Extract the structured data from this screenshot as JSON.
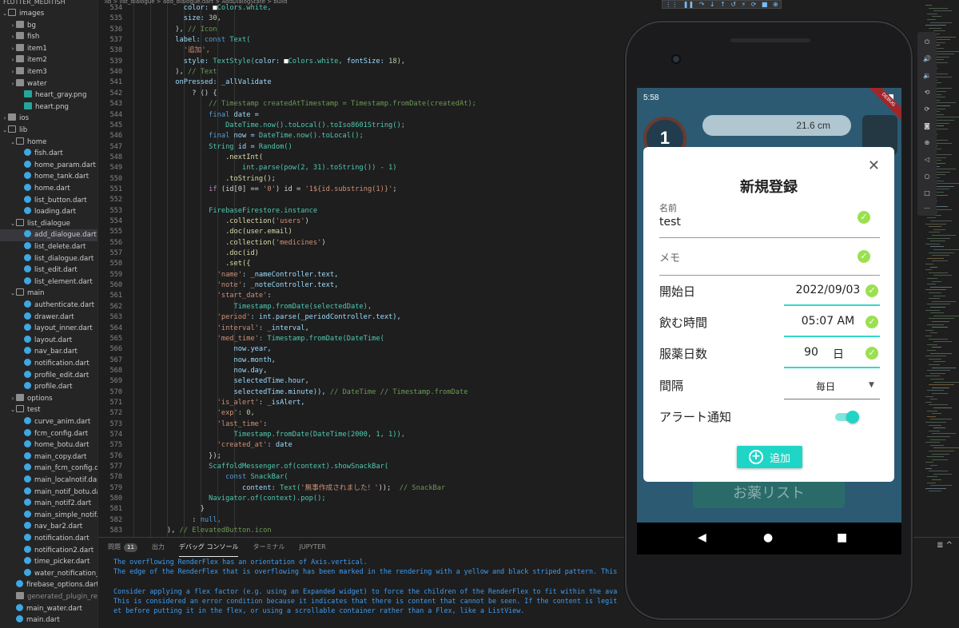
{
  "explorer": {
    "header": "FLUTTER_MEDITISH",
    "items": [
      {
        "label": "images",
        "kind": "folder-open",
        "indent": 0,
        "chev": "v"
      },
      {
        "label": "bg",
        "kind": "folder",
        "indent": 1,
        "chev": ">"
      },
      {
        "label": "fish",
        "kind": "folder",
        "indent": 1,
        "chev": ">"
      },
      {
        "label": "item1",
        "kind": "folder",
        "indent": 1,
        "chev": ">"
      },
      {
        "label": "item2",
        "kind": "folder",
        "indent": 1,
        "chev": ">"
      },
      {
        "label": "item3",
        "kind": "folder",
        "indent": 1,
        "chev": ">"
      },
      {
        "label": "water",
        "kind": "folder",
        "indent": 1,
        "chev": ">"
      },
      {
        "label": "heart_gray.png",
        "kind": "png",
        "indent": 2,
        "chev": ""
      },
      {
        "label": "heart.png",
        "kind": "png",
        "indent": 2,
        "chev": ""
      },
      {
        "label": "ios",
        "kind": "folder",
        "indent": 0,
        "chev": ">"
      },
      {
        "label": "lib",
        "kind": "folder-open",
        "indent": 0,
        "chev": "v"
      },
      {
        "label": "home",
        "kind": "folder-open",
        "indent": 1,
        "chev": "v"
      },
      {
        "label": "fish.dart",
        "kind": "dart",
        "indent": 2,
        "chev": ""
      },
      {
        "label": "home_param.dart",
        "kind": "dart",
        "indent": 2,
        "chev": ""
      },
      {
        "label": "home_tank.dart",
        "kind": "dart",
        "indent": 2,
        "chev": ""
      },
      {
        "label": "home.dart",
        "kind": "dart",
        "indent": 2,
        "chev": ""
      },
      {
        "label": "list_button.dart",
        "kind": "dart",
        "indent": 2,
        "chev": ""
      },
      {
        "label": "loading.dart",
        "kind": "dart",
        "indent": 2,
        "chev": ""
      },
      {
        "label": "list_dialogue",
        "kind": "folder-open",
        "indent": 1,
        "chev": "v"
      },
      {
        "label": "add_dialogue.dart",
        "kind": "dart",
        "indent": 2,
        "chev": "",
        "selected": true
      },
      {
        "label": "list_delete.dart",
        "kind": "dart",
        "indent": 2,
        "chev": ""
      },
      {
        "label": "list_dialogue.dart",
        "kind": "dart",
        "indent": 2,
        "chev": ""
      },
      {
        "label": "list_edit.dart",
        "kind": "dart",
        "indent": 2,
        "chev": ""
      },
      {
        "label": "list_element.dart",
        "kind": "dart",
        "indent": 2,
        "chev": ""
      },
      {
        "label": "main",
        "kind": "folder-open",
        "indent": 1,
        "chev": "v"
      },
      {
        "label": "authenticate.dart",
        "kind": "dart",
        "indent": 2,
        "chev": ""
      },
      {
        "label": "drawer.dart",
        "kind": "dart",
        "indent": 2,
        "chev": ""
      },
      {
        "label": "layout_inner.dart",
        "kind": "dart",
        "indent": 2,
        "chev": ""
      },
      {
        "label": "layout.dart",
        "kind": "dart",
        "indent": 2,
        "chev": ""
      },
      {
        "label": "nav_bar.dart",
        "kind": "dart",
        "indent": 2,
        "chev": ""
      },
      {
        "label": "notification.dart",
        "kind": "dart",
        "indent": 2,
        "chev": ""
      },
      {
        "label": "profile_edit.dart",
        "kind": "dart",
        "indent": 2,
        "chev": ""
      },
      {
        "label": "profile.dart",
        "kind": "dart",
        "indent": 2,
        "chev": ""
      },
      {
        "label": "options",
        "kind": "folder",
        "indent": 1,
        "chev": ">"
      },
      {
        "label": "test",
        "kind": "folder-open",
        "indent": 1,
        "chev": "v"
      },
      {
        "label": "curve_anim.dart",
        "kind": "dart",
        "indent": 2,
        "chev": ""
      },
      {
        "label": "fcm_config.dart",
        "kind": "dart",
        "indent": 2,
        "chev": ""
      },
      {
        "label": "home_botu.dart",
        "kind": "dart",
        "indent": 2,
        "chev": ""
      },
      {
        "label": "main_copy.dart",
        "kind": "dart",
        "indent": 2,
        "chev": ""
      },
      {
        "label": "main_fcm_config.d...",
        "kind": "dart",
        "indent": 2,
        "chev": ""
      },
      {
        "label": "main_localnotif.dart",
        "kind": "dart",
        "indent": 2,
        "chev": ""
      },
      {
        "label": "main_notif_botu.dart",
        "kind": "dart",
        "indent": 2,
        "chev": ""
      },
      {
        "label": "main_notif2.dart",
        "kind": "dart",
        "indent": 2,
        "chev": ""
      },
      {
        "label": "main_simple_notif...",
        "kind": "dart",
        "indent": 2,
        "chev": ""
      },
      {
        "label": "nav_bar2.dart",
        "kind": "dart",
        "indent": 2,
        "chev": ""
      },
      {
        "label": "notification.dart",
        "kind": "dart",
        "indent": 2,
        "chev": ""
      },
      {
        "label": "notification2.dart",
        "kind": "dart",
        "indent": 2,
        "chev": ""
      },
      {
        "label": "time_picker.dart",
        "kind": "dart",
        "indent": 2,
        "chev": ""
      },
      {
        "label": "water_notification_...",
        "kind": "dart",
        "indent": 2,
        "chev": ""
      },
      {
        "label": "firebase_options.dart",
        "kind": "dart",
        "indent": 1,
        "chev": ""
      },
      {
        "label": "generated_plugin_re...",
        "kind": "gen",
        "indent": 1,
        "chev": "",
        "dim": true
      },
      {
        "label": "main_water.dart",
        "kind": "dart",
        "indent": 1,
        "chev": ""
      },
      {
        "label": "main.dart",
        "kind": "dart",
        "indent": 1,
        "chev": ""
      }
    ]
  },
  "editor": {
    "breadcrumb": "lib > list_dialogue > add_dialogue.dart > AddDialogState > build",
    "first_line": 534,
    "lines": [
      [
        {
          "t": "            color: ",
          "c": "#9cdcfe"
        },
        {
          "t": "■",
          "c": "#ffffff"
        },
        {
          "t": "Colors.white,",
          "c": "#4ec9b0"
        }
      ],
      [
        {
          "t": "            size: ",
          "c": "#9cdcfe"
        },
        {
          "t": "30,",
          "c": "#b5cea8"
        }
      ],
      [
        {
          "t": "          ), ",
          "c": "#d4d4d4"
        },
        {
          "t": "// Icon",
          "c": "#6a9955"
        }
      ],
      [
        {
          "t": "          label: ",
          "c": "#9cdcfe"
        },
        {
          "t": "const ",
          "c": "#569cd6"
        },
        {
          "t": "Text(",
          "c": "#4ec9b0"
        }
      ],
      [
        {
          "t": "            '追加',",
          "c": "#ce9178"
        }
      ],
      [
        {
          "t": "            style: ",
          "c": "#9cdcfe"
        },
        {
          "t": "TextStyle(",
          "c": "#4ec9b0"
        },
        {
          "t": "color: ",
          "c": "#9cdcfe"
        },
        {
          "t": "■",
          "c": "#ffffff"
        },
        {
          "t": "Colors.white, ",
          "c": "#4ec9b0"
        },
        {
          "t": "fontSize: ",
          "c": "#9cdcfe"
        },
        {
          "t": "18),",
          "c": "#b5cea8"
        }
      ],
      [
        {
          "t": "          ), ",
          "c": "#d4d4d4"
        },
        {
          "t": "// Text",
          "c": "#6a9955"
        }
      ],
      [
        {
          "t": "          onPressed: ",
          "c": "#9cdcfe"
        },
        {
          "t": "_allValidate",
          "c": "#9cdcfe"
        }
      ],
      [
        {
          "t": "              ? () {",
          "c": "#d4d4d4"
        }
      ],
      [
        {
          "t": "                  // Timestamp createdAtTimestamp = Timestamp.fromDate(createdAt);",
          "c": "#6a9955"
        }
      ],
      [
        {
          "t": "                  final ",
          "c": "#569cd6"
        },
        {
          "t": "date =",
          "c": "#9cdcfe"
        }
      ],
      [
        {
          "t": "                      DateTime.now().toLocal().toIso8601String();",
          "c": "#4ec9b0"
        }
      ],
      [
        {
          "t": "                  final ",
          "c": "#569cd6"
        },
        {
          "t": "now = ",
          "c": "#9cdcfe"
        },
        {
          "t": "DateTime.now().toLocal();",
          "c": "#4ec9b0"
        }
      ],
      [
        {
          "t": "                  String ",
          "c": "#4ec9b0"
        },
        {
          "t": "id = ",
          "c": "#9cdcfe"
        },
        {
          "t": "Random()",
          "c": "#4ec9b0"
        }
      ],
      [
        {
          "t": "                      .nextInt(",
          "c": "#dcdcaa"
        }
      ],
      [
        {
          "t": "                          int.parse(pow(2, 31).toString()) - 1)",
          "c": "#4ec9b0"
        }
      ],
      [
        {
          "t": "                      .toString();",
          "c": "#dcdcaa"
        }
      ],
      [
        {
          "t": "                  if ",
          "c": "#c586c0"
        },
        {
          "t": "(id[0] == ",
          "c": "#d4d4d4"
        },
        {
          "t": "'0'",
          "c": "#ce9178"
        },
        {
          "t": ") id = ",
          "c": "#d4d4d4"
        },
        {
          "t": "'1${id.substring(1)}'",
          "c": "#ce9178"
        },
        {
          "t": ";",
          "c": "#d4d4d4"
        }
      ],
      [
        {
          "t": "",
          "c": "#d4d4d4"
        }
      ],
      [
        {
          "t": "                  FirebaseFirestore.instance",
          "c": "#4ec9b0"
        }
      ],
      [
        {
          "t": "                      .collection(",
          "c": "#dcdcaa"
        },
        {
          "t": "'users'",
          "c": "#ce9178"
        },
        {
          "t": ")",
          "c": "#d4d4d4"
        }
      ],
      [
        {
          "t": "                      .doc(user.email)",
          "c": "#dcdcaa"
        }
      ],
      [
        {
          "t": "                      .collection(",
          "c": "#dcdcaa"
        },
        {
          "t": "'medicines'",
          "c": "#ce9178"
        },
        {
          "t": ")",
          "c": "#d4d4d4"
        }
      ],
      [
        {
          "t": "                      .doc(id)",
          "c": "#dcdcaa"
        }
      ],
      [
        {
          "t": "                      .set({",
          "c": "#dcdcaa"
        }
      ],
      [
        {
          "t": "                    'name'",
          "c": "#ce9178"
        },
        {
          "t": ": _nameController.text,",
          "c": "#9cdcfe"
        }
      ],
      [
        {
          "t": "                    'note'",
          "c": "#ce9178"
        },
        {
          "t": ": _noteController.text,",
          "c": "#9cdcfe"
        }
      ],
      [
        {
          "t": "                    'start_date'",
          "c": "#ce9178"
        },
        {
          "t": ":",
          "c": "#d4d4d4"
        }
      ],
      [
        {
          "t": "                        Timestamp.fromDate(selectedDate),",
          "c": "#4ec9b0"
        }
      ],
      [
        {
          "t": "                    'period'",
          "c": "#ce9178"
        },
        {
          "t": ": int.parse(_periodController.text),",
          "c": "#9cdcfe"
        }
      ],
      [
        {
          "t": "                    'interval'",
          "c": "#ce9178"
        },
        {
          "t": ": _interval,",
          "c": "#9cdcfe"
        }
      ],
      [
        {
          "t": "                    'med_time'",
          "c": "#ce9178"
        },
        {
          "t": ": Timestamp.fromDate(DateTime(",
          "c": "#4ec9b0"
        }
      ],
      [
        {
          "t": "                        now.year,",
          "c": "#9cdcfe"
        }
      ],
      [
        {
          "t": "                        now.month,",
          "c": "#9cdcfe"
        }
      ],
      [
        {
          "t": "                        now.day,",
          "c": "#9cdcfe"
        }
      ],
      [
        {
          "t": "                        selectedTime.hour,",
          "c": "#9cdcfe"
        }
      ],
      [
        {
          "t": "                        selectedTime.minute)), ",
          "c": "#9cdcfe"
        },
        {
          "t": "// DateTime // Timestamp.fromDate",
          "c": "#6a9955"
        }
      ],
      [
        {
          "t": "                    'is_alert'",
          "c": "#ce9178"
        },
        {
          "t": ": _isAlert,",
          "c": "#9cdcfe"
        }
      ],
      [
        {
          "t": "                    'exp'",
          "c": "#ce9178"
        },
        {
          "t": ": 0,",
          "c": "#b5cea8"
        }
      ],
      [
        {
          "t": "                    'last_time'",
          "c": "#ce9178"
        },
        {
          "t": ":",
          "c": "#d4d4d4"
        }
      ],
      [
        {
          "t": "                        Timestamp.fromDate(DateTime(2000, 1, 1)),",
          "c": "#4ec9b0"
        }
      ],
      [
        {
          "t": "                    'created_at'",
          "c": "#ce9178"
        },
        {
          "t": ": date",
          "c": "#9cdcfe"
        }
      ],
      [
        {
          "t": "                  });",
          "c": "#d4d4d4"
        }
      ],
      [
        {
          "t": "                  ScaffoldMessenger.of(context).showSnackBar(",
          "c": "#4ec9b0"
        }
      ],
      [
        {
          "t": "                      const ",
          "c": "#569cd6"
        },
        {
          "t": "SnackBar(",
          "c": "#4ec9b0"
        }
      ],
      [
        {
          "t": "                          content: ",
          "c": "#9cdcfe"
        },
        {
          "t": "Text(",
          "c": "#4ec9b0"
        },
        {
          "t": "'無事作成されました！'",
          "c": "#ce9178"
        },
        {
          "t": "));  ",
          "c": "#d4d4d4"
        },
        {
          "t": "// SnackBar",
          "c": "#6a9955"
        }
      ],
      [
        {
          "t": "                  Navigator.of(context).pop();",
          "c": "#4ec9b0"
        }
      ],
      [
        {
          "t": "                }",
          "c": "#d4d4d4"
        }
      ],
      [
        {
          "t": "              : ",
          "c": "#d4d4d4"
        },
        {
          "t": "null,",
          "c": "#569cd6"
        }
      ],
      [
        {
          "t": "        ), ",
          "c": "#d4d4d4"
        },
        {
          "t": "// ElevatedButton.icon",
          "c": "#6a9955"
        }
      ]
    ]
  },
  "debug_toolbar": {
    "icons": [
      "⋮⋮",
      "❚❚",
      "↷",
      "↓",
      "↑",
      "↺",
      "⚡",
      "⟳",
      "■",
      "⊕"
    ]
  },
  "panel": {
    "tabs": [
      {
        "label": "問題",
        "badge": "11"
      },
      {
        "label": "出力"
      },
      {
        "label": "デバッグ コンソール",
        "active": true
      },
      {
        "label": "ターミナル"
      },
      {
        "label": "JUPYTER"
      }
    ],
    "right_icon": "≣  ^",
    "output": [
      "The overflowing RenderFlex has an orientation of Axis.vertical.",
      "The edge of the RenderFlex that is overflowing has been marked in the rendering with a yellow and black striped pattern. This",
      "",
      "Consider applying a flex factor (e.g. using an Expanded widget) to force the children of the RenderFlex to fit within the ava",
      "This is considered an error condition because it indicates that there is content that cannot be seen. If the content is legit                      ClipRect widg",
      "et before putting it in the flex, or using a scrollable container rather than a Flex, like a ListView."
    ]
  },
  "phone": {
    "status_time": "5:58",
    "debug_ribbon": "DEBUG",
    "bg_timer": "1",
    "bg_size": "21.6 cm",
    "bg_list": "お薬リスト",
    "dialog": {
      "title": "新規登録",
      "name_label": "名前",
      "name_value": "test",
      "memo_label": "メモ",
      "start_label": "開始日",
      "start_value": "2022/09/03",
      "time_label": "飲む時間",
      "time_value": "05:07 AM",
      "days_label": "服薬日数",
      "days_value": "90",
      "days_unit": "日",
      "interval_label": "間隔",
      "interval_value": "毎日",
      "alert_label": "アラート通知",
      "alert_on": true,
      "add_label": "追加",
      "accent": "#1fd5c5",
      "check_color": "#9be04f"
    }
  }
}
